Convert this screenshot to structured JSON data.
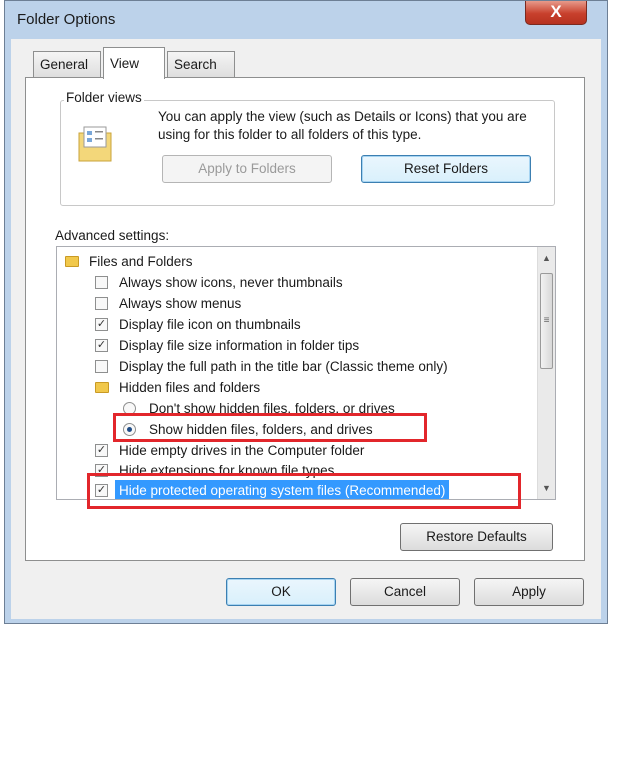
{
  "window": {
    "title": "Folder Options",
    "close_label": "X"
  },
  "tabs": [
    {
      "label": "General"
    },
    {
      "label": "View"
    },
    {
      "label": "Search"
    }
  ],
  "folder_views": {
    "group_label": "Folder views",
    "description": "You can apply the view (such as Details or Icons) that you are using for this folder to all folders of this type.",
    "apply_button": "Apply to Folders",
    "reset_button": "Reset Folders"
  },
  "advanced": {
    "label": "Advanced settings:",
    "items": [
      {
        "label": "Files and Folders",
        "kind": "folder"
      },
      {
        "label": "Always show icons, never thumbnails",
        "kind": "checkbox",
        "checked": false
      },
      {
        "label": "Always show menus",
        "kind": "checkbox",
        "checked": false
      },
      {
        "label": "Display file icon on thumbnails",
        "kind": "checkbox",
        "checked": true
      },
      {
        "label": "Display file size information in folder tips",
        "kind": "checkbox",
        "checked": true
      },
      {
        "label": "Display the full path in the title bar (Classic theme only)",
        "kind": "checkbox",
        "checked": false
      },
      {
        "label": "Hidden files and folders",
        "kind": "folder"
      },
      {
        "label": "Don't show hidden files, folders, or drives",
        "kind": "radio",
        "checked": false
      },
      {
        "label": "Show hidden files, folders, and drives",
        "kind": "radio",
        "checked": true
      },
      {
        "label": "Hide empty drives in the Computer folder",
        "kind": "checkbox",
        "checked": true
      },
      {
        "label": "Hide extensions for known file types",
        "kind": "checkbox",
        "checked": true
      },
      {
        "label": "Hide protected operating system files (Recommended)",
        "kind": "checkbox",
        "checked": true,
        "selected": true
      }
    ],
    "restore_button": "Restore Defaults"
  },
  "footer": {
    "ok": "OK",
    "cancel": "Cancel",
    "apply": "Apply"
  },
  "colors": {
    "highlight": "#e2262b",
    "selection": "#3399ff",
    "window_frame": "#bcd2ea"
  }
}
